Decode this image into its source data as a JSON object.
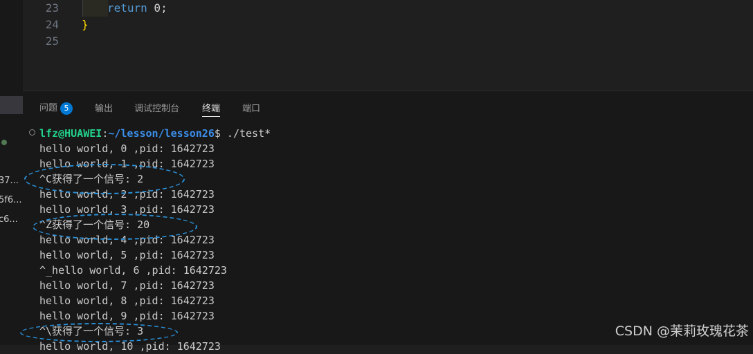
{
  "sidebar": {
    "truncated_items": [
      "37...",
      "5f6...",
      "c6..."
    ]
  },
  "editor": {
    "lines": [
      {
        "number": "23",
        "keyword": "return",
        "rest": " 0;"
      },
      {
        "number": "24",
        "text": "}"
      },
      {
        "number": "25",
        "text": ""
      }
    ]
  },
  "panel": {
    "tabs": [
      {
        "label": "问题",
        "badge": "5"
      },
      {
        "label": "输出"
      },
      {
        "label": "调试控制台"
      },
      {
        "label": "终端",
        "active": true
      },
      {
        "label": "端口"
      }
    ]
  },
  "terminal": {
    "prompt_user": "lfz@HUAWEI",
    "prompt_sep": ":",
    "prompt_path": "~/lesson/lesson26",
    "prompt_cmd": "$ ./test*",
    "lines": [
      "hello world, 0 ,pid: 1642723",
      "hello world, 1 ,pid: 1642723",
      "^C获得了一个信号: 2",
      "hello world, 2 ,pid: 1642723",
      "hello world, 3 ,pid: 1642723",
      "^Z获得了一个信号: 20",
      "hello world, 4 ,pid: 1642723",
      "hello world, 5 ,pid: 1642723",
      "^_hello world, 6 ,pid: 1642723",
      "hello world, 7 ,pid: 1642723",
      "hello world, 8 ,pid: 1642723",
      "hello world, 9 ,pid: 1642723",
      "^\\获得了一个信号: 3",
      "hello world, 10 ,pid: 1642723"
    ]
  },
  "colors": {
    "annotation": "#2a8fd6",
    "prompt_user": "#23d18b",
    "prompt_path": "#3b8eea"
  },
  "watermark": "CSDN @茉莉玫瑰花茶"
}
